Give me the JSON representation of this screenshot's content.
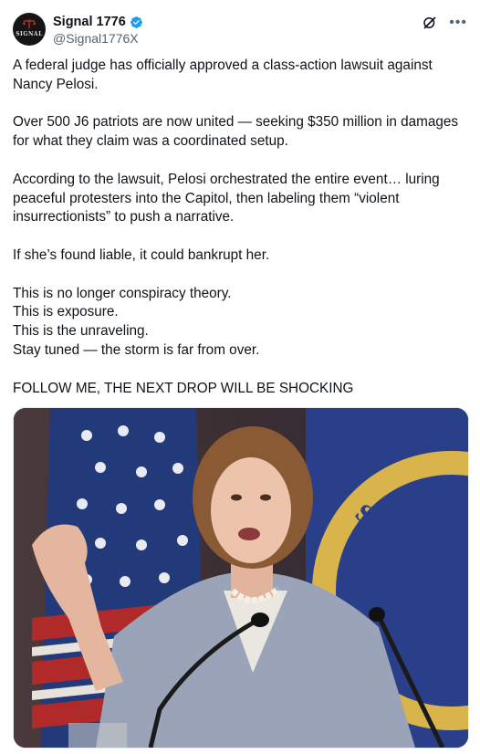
{
  "author": {
    "display_name": "Signal 1776",
    "handle": "@Signal1776X",
    "avatar_text": "SIGNAL"
  },
  "icons": {
    "verified": "verified-badge-icon",
    "grok": "grok-icon",
    "more": "more-icon"
  },
  "post": {
    "paragraphs": [
      "A federal judge has officially approved a class-action lawsuit against Nancy Pelosi.",
      "Over 500 J6 patriots are now united — seeking $350 million in damages for what they claim was a coordinated setup.",
      "According to the lawsuit, Pelosi orchestrated the entire event… luring peaceful protesters into the Capitol, then labeling them “violent insurrectionists” to push a narrative.",
      "If she’s found liable, it could bankrupt her.",
      "This is no longer conspiracy theory.",
      "This is exposure.",
      "This is the unraveling.",
      "Stay tuned — the storm is far from over.",
      "FOLLOW ME, THE NEXT DROP WILL BE SHOCKING"
    ]
  },
  "media": {
    "seal_text": "S. HOUSE"
  },
  "colors": {
    "verified": "#1d9bf0",
    "text": "#0f1419",
    "secondary": "#536471"
  }
}
